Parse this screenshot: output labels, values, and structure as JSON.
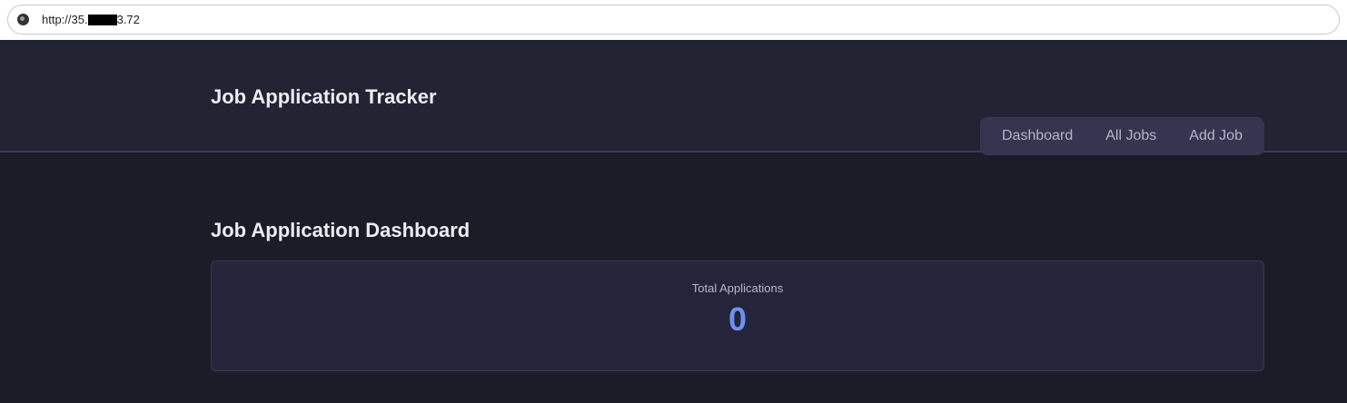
{
  "browser": {
    "url_prefix": "http://35.",
    "url_suffix": "3.72"
  },
  "header": {
    "title": "Job Application Tracker",
    "nav": [
      "Dashboard",
      "All Jobs",
      "Add Job"
    ]
  },
  "main": {
    "heading": "Job Application Dashboard",
    "stats": {
      "label": "Total Applications",
      "value": "0"
    }
  },
  "colors": {
    "accent": "#6f8fef"
  }
}
